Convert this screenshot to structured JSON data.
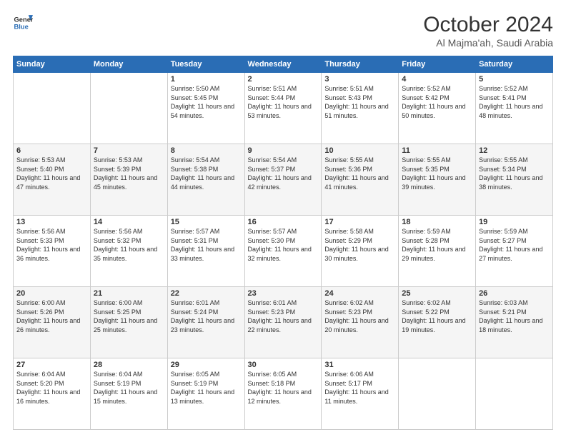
{
  "header": {
    "logo_line1": "General",
    "logo_line2": "Blue",
    "month": "October 2024",
    "location": "Al Majma'ah, Saudi Arabia"
  },
  "weekdays": [
    "Sunday",
    "Monday",
    "Tuesday",
    "Wednesday",
    "Thursday",
    "Friday",
    "Saturday"
  ],
  "weeks": [
    [
      {
        "day": "",
        "sunrise": "",
        "sunset": "",
        "daylight": ""
      },
      {
        "day": "",
        "sunrise": "",
        "sunset": "",
        "daylight": ""
      },
      {
        "day": "1",
        "sunrise": "Sunrise: 5:50 AM",
        "sunset": "Sunset: 5:45 PM",
        "daylight": "Daylight: 11 hours and 54 minutes."
      },
      {
        "day": "2",
        "sunrise": "Sunrise: 5:51 AM",
        "sunset": "Sunset: 5:44 PM",
        "daylight": "Daylight: 11 hours and 53 minutes."
      },
      {
        "day": "3",
        "sunrise": "Sunrise: 5:51 AM",
        "sunset": "Sunset: 5:43 PM",
        "daylight": "Daylight: 11 hours and 51 minutes."
      },
      {
        "day": "4",
        "sunrise": "Sunrise: 5:52 AM",
        "sunset": "Sunset: 5:42 PM",
        "daylight": "Daylight: 11 hours and 50 minutes."
      },
      {
        "day": "5",
        "sunrise": "Sunrise: 5:52 AM",
        "sunset": "Sunset: 5:41 PM",
        "daylight": "Daylight: 11 hours and 48 minutes."
      }
    ],
    [
      {
        "day": "6",
        "sunrise": "Sunrise: 5:53 AM",
        "sunset": "Sunset: 5:40 PM",
        "daylight": "Daylight: 11 hours and 47 minutes."
      },
      {
        "day": "7",
        "sunrise": "Sunrise: 5:53 AM",
        "sunset": "Sunset: 5:39 PM",
        "daylight": "Daylight: 11 hours and 45 minutes."
      },
      {
        "day": "8",
        "sunrise": "Sunrise: 5:54 AM",
        "sunset": "Sunset: 5:38 PM",
        "daylight": "Daylight: 11 hours and 44 minutes."
      },
      {
        "day": "9",
        "sunrise": "Sunrise: 5:54 AM",
        "sunset": "Sunset: 5:37 PM",
        "daylight": "Daylight: 11 hours and 42 minutes."
      },
      {
        "day": "10",
        "sunrise": "Sunrise: 5:55 AM",
        "sunset": "Sunset: 5:36 PM",
        "daylight": "Daylight: 11 hours and 41 minutes."
      },
      {
        "day": "11",
        "sunrise": "Sunrise: 5:55 AM",
        "sunset": "Sunset: 5:35 PM",
        "daylight": "Daylight: 11 hours and 39 minutes."
      },
      {
        "day": "12",
        "sunrise": "Sunrise: 5:55 AM",
        "sunset": "Sunset: 5:34 PM",
        "daylight": "Daylight: 11 hours and 38 minutes."
      }
    ],
    [
      {
        "day": "13",
        "sunrise": "Sunrise: 5:56 AM",
        "sunset": "Sunset: 5:33 PM",
        "daylight": "Daylight: 11 hours and 36 minutes."
      },
      {
        "day": "14",
        "sunrise": "Sunrise: 5:56 AM",
        "sunset": "Sunset: 5:32 PM",
        "daylight": "Daylight: 11 hours and 35 minutes."
      },
      {
        "day": "15",
        "sunrise": "Sunrise: 5:57 AM",
        "sunset": "Sunset: 5:31 PM",
        "daylight": "Daylight: 11 hours and 33 minutes."
      },
      {
        "day": "16",
        "sunrise": "Sunrise: 5:57 AM",
        "sunset": "Sunset: 5:30 PM",
        "daylight": "Daylight: 11 hours and 32 minutes."
      },
      {
        "day": "17",
        "sunrise": "Sunrise: 5:58 AM",
        "sunset": "Sunset: 5:29 PM",
        "daylight": "Daylight: 11 hours and 30 minutes."
      },
      {
        "day": "18",
        "sunrise": "Sunrise: 5:59 AM",
        "sunset": "Sunset: 5:28 PM",
        "daylight": "Daylight: 11 hours and 29 minutes."
      },
      {
        "day": "19",
        "sunrise": "Sunrise: 5:59 AM",
        "sunset": "Sunset: 5:27 PM",
        "daylight": "Daylight: 11 hours and 27 minutes."
      }
    ],
    [
      {
        "day": "20",
        "sunrise": "Sunrise: 6:00 AM",
        "sunset": "Sunset: 5:26 PM",
        "daylight": "Daylight: 11 hours and 26 minutes."
      },
      {
        "day": "21",
        "sunrise": "Sunrise: 6:00 AM",
        "sunset": "Sunset: 5:25 PM",
        "daylight": "Daylight: 11 hours and 25 minutes."
      },
      {
        "day": "22",
        "sunrise": "Sunrise: 6:01 AM",
        "sunset": "Sunset: 5:24 PM",
        "daylight": "Daylight: 11 hours and 23 minutes."
      },
      {
        "day": "23",
        "sunrise": "Sunrise: 6:01 AM",
        "sunset": "Sunset: 5:23 PM",
        "daylight": "Daylight: 11 hours and 22 minutes."
      },
      {
        "day": "24",
        "sunrise": "Sunrise: 6:02 AM",
        "sunset": "Sunset: 5:23 PM",
        "daylight": "Daylight: 11 hours and 20 minutes."
      },
      {
        "day": "25",
        "sunrise": "Sunrise: 6:02 AM",
        "sunset": "Sunset: 5:22 PM",
        "daylight": "Daylight: 11 hours and 19 minutes."
      },
      {
        "day": "26",
        "sunrise": "Sunrise: 6:03 AM",
        "sunset": "Sunset: 5:21 PM",
        "daylight": "Daylight: 11 hours and 18 minutes."
      }
    ],
    [
      {
        "day": "27",
        "sunrise": "Sunrise: 6:04 AM",
        "sunset": "Sunset: 5:20 PM",
        "daylight": "Daylight: 11 hours and 16 minutes."
      },
      {
        "day": "28",
        "sunrise": "Sunrise: 6:04 AM",
        "sunset": "Sunset: 5:19 PM",
        "daylight": "Daylight: 11 hours and 15 minutes."
      },
      {
        "day": "29",
        "sunrise": "Sunrise: 6:05 AM",
        "sunset": "Sunset: 5:19 PM",
        "daylight": "Daylight: 11 hours and 13 minutes."
      },
      {
        "day": "30",
        "sunrise": "Sunrise: 6:05 AM",
        "sunset": "Sunset: 5:18 PM",
        "daylight": "Daylight: 11 hours and 12 minutes."
      },
      {
        "day": "31",
        "sunrise": "Sunrise: 6:06 AM",
        "sunset": "Sunset: 5:17 PM",
        "daylight": "Daylight: 11 hours and 11 minutes."
      },
      {
        "day": "",
        "sunrise": "",
        "sunset": "",
        "daylight": ""
      },
      {
        "day": "",
        "sunrise": "",
        "sunset": "",
        "daylight": ""
      }
    ]
  ]
}
